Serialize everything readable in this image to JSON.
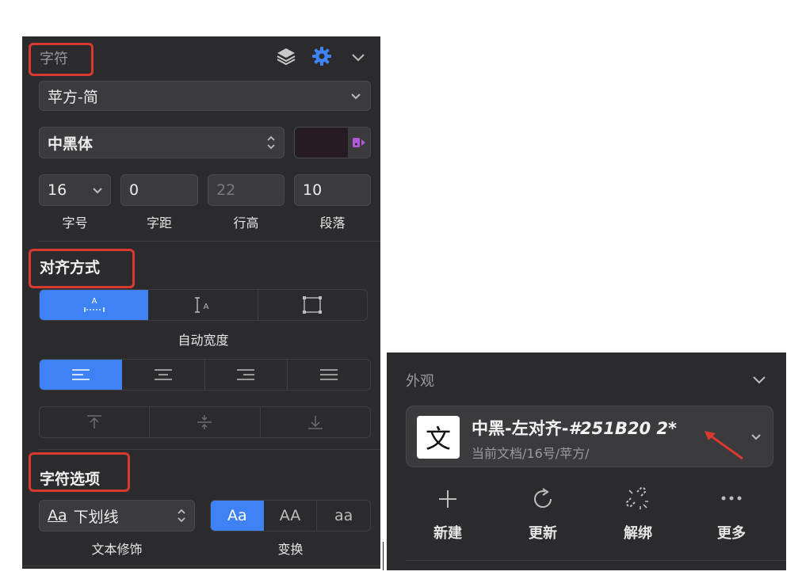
{
  "left": {
    "character": {
      "title": "字符",
      "font_family": "苹方-简",
      "font_weight": "中黑体",
      "font_size": "16",
      "letter_spacing": "0",
      "line_height": "22",
      "paragraph": "10",
      "labels": {
        "size": "字号",
        "spacing": "字距",
        "line_height": "行高",
        "paragraph": "段落"
      },
      "color_swatch": "#251B20"
    },
    "alignment": {
      "title": "对齐方式",
      "sizing_label": "自动宽度"
    },
    "options": {
      "title": "字符选项",
      "decoration_sample": "Aa",
      "decoration_value": "下划线",
      "decoration_label": "文本修饰",
      "transform_label": "变换",
      "transform_options": [
        "Aa",
        "AA",
        "aa"
      ]
    }
  },
  "right": {
    "appearance": {
      "title": "外观",
      "style_icon_char": "文",
      "style_name": "中黑-左对齐-",
      "style_name_suffix": "#251B20 2*",
      "style_sub": "当前文档/16号/苹方/",
      "actions": [
        "新建",
        "更新",
        "解绑",
        "更多"
      ]
    }
  },
  "colors": {
    "accent": "#3f82f5",
    "highlight_box": "#d93a2f",
    "panel": "#2b2b2d"
  }
}
